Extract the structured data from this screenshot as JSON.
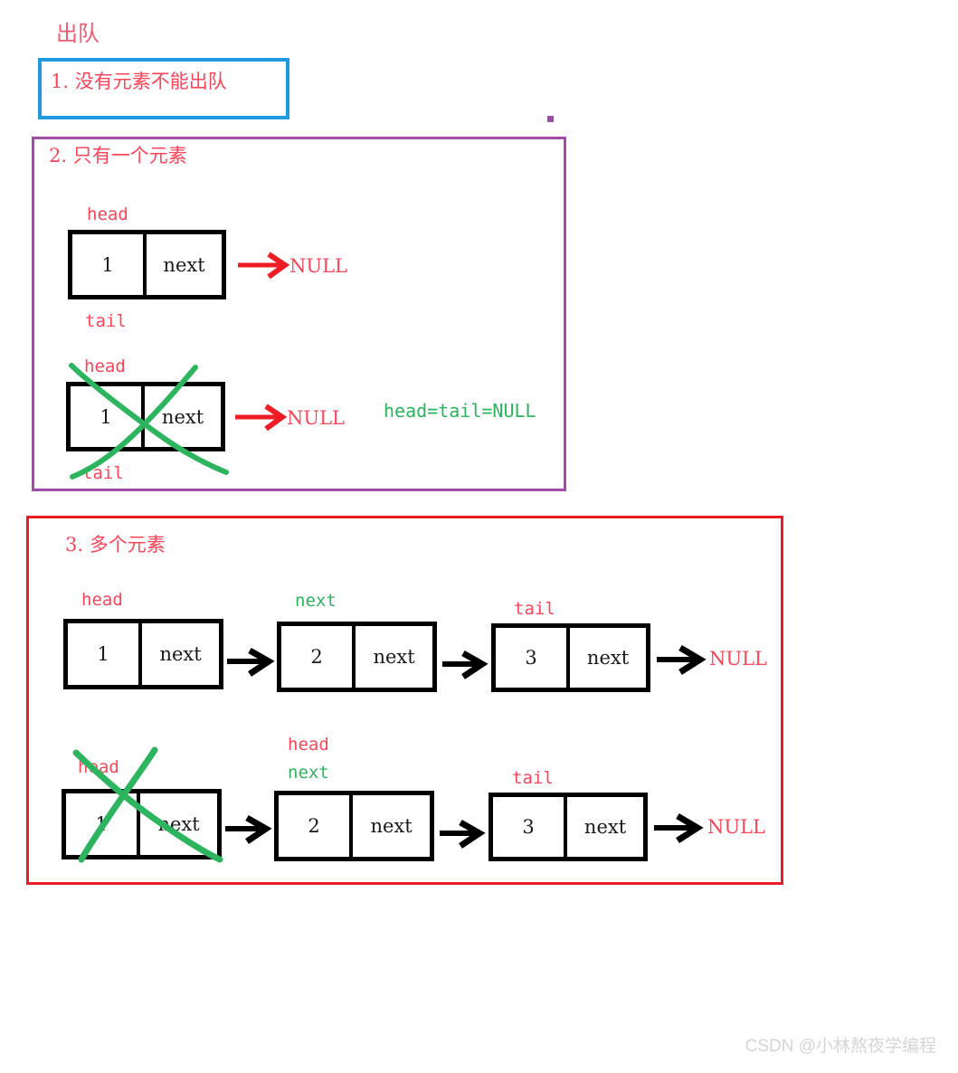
{
  "title": "出队",
  "watermark": "CSDN @小林熬夜学编程",
  "colors": {
    "heading_red": "#f05a6e",
    "label_red": "#fa4659",
    "blue_border": "#1f9ade",
    "purple_border": "#a34bab",
    "red_border": "#ec1c24",
    "green_ink": "#2db45e",
    "node_black": "#000000",
    "arrow_red": "#ee1c25",
    "arrow_black": "#000000",
    "watermark_gray": "#d5d5d5"
  },
  "sections": [
    {
      "id": "case-1",
      "label": "1. 没有元素不能出队",
      "border_color": "#1f9ade"
    },
    {
      "id": "case-2",
      "label": "2. 只有一个元素",
      "border_color": "#a34bab",
      "rows": [
        {
          "id": "before",
          "labels_above": [
            "head"
          ],
          "label_below": "tail",
          "nodes": [
            {
              "value": "1",
              "next_label": "next"
            }
          ],
          "terminator": "NULL",
          "crossed_out": false
        },
        {
          "id": "after",
          "labels_above": [
            "head"
          ],
          "label_below": "tail",
          "nodes": [
            {
              "value": "1",
              "next_label": "next"
            }
          ],
          "terminator": "NULL",
          "crossed_out": true,
          "note": "head=tail=NULL"
        }
      ]
    },
    {
      "id": "case-3",
      "label": "3. 多个元素",
      "border_color": "#ec1c24",
      "rows": [
        {
          "id": "before",
          "nodes": [
            {
              "value": "1",
              "next_label": "next",
              "label_red": "head",
              "label_green": ""
            },
            {
              "value": "2",
              "next_label": "next",
              "label_red": "",
              "label_green": "next"
            },
            {
              "value": "3",
              "next_label": "next",
              "label_red": "tail",
              "label_green": ""
            }
          ],
          "terminator": "NULL",
          "crossed_out": false
        },
        {
          "id": "after",
          "nodes": [
            {
              "value": "1",
              "next_label": "next",
              "label_red": "head",
              "label_green": ""
            },
            {
              "value": "2",
              "next_label": "next",
              "label_red": "head",
              "label_green": "next"
            },
            {
              "value": "3",
              "next_label": "next",
              "label_red": "tail",
              "label_green": ""
            }
          ],
          "terminator": "NULL",
          "crossed_out": true
        }
      ]
    }
  ]
}
